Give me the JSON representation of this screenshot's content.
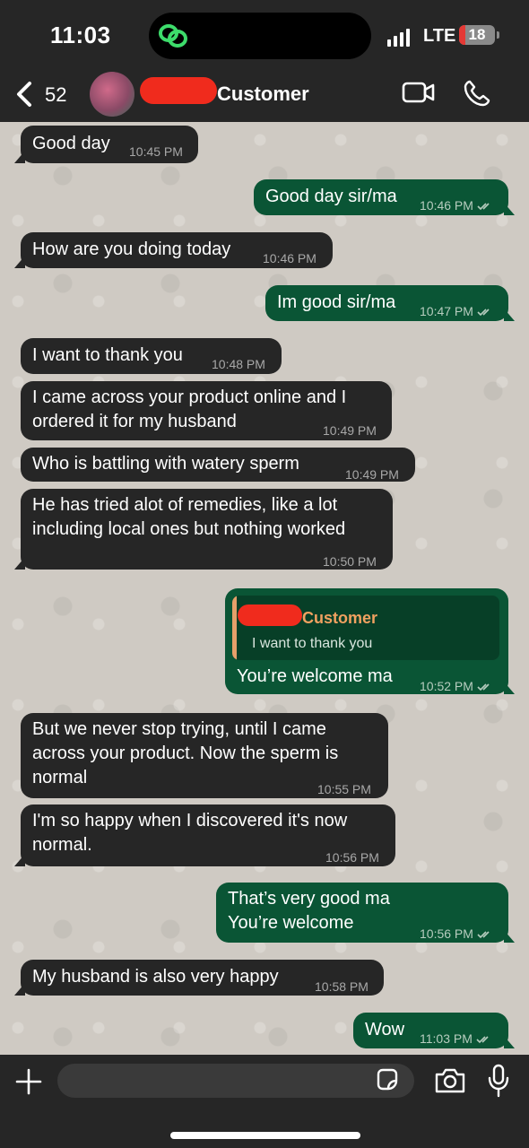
{
  "status_bar": {
    "time": "11:03",
    "network": "LTE",
    "battery_level": "18",
    "battery_fraction": 0.18
  },
  "header": {
    "back_count": "52",
    "contact_name": "Customer",
    "icons": [
      "chevron-left-icon",
      "video-call-icon",
      "phone-icon"
    ]
  },
  "messages": [
    {
      "dir": "in",
      "text": "Good day",
      "time": "10:45 PM"
    },
    {
      "dir": "out",
      "text": "Good day sir/ma",
      "time": "10:46 PM"
    },
    {
      "dir": "in",
      "text": "How are you doing today",
      "time": "10:46 PM"
    },
    {
      "dir": "out",
      "text": "Im good sir/ma",
      "time": "10:47 PM"
    },
    {
      "dir": "in",
      "text": "I want to thank you",
      "time": "10:48 PM"
    },
    {
      "dir": "in",
      "lines": [
        "I came across your product online and I",
        "ordered it for my husband"
      ],
      "time": "10:49 PM"
    },
    {
      "dir": "in",
      "text": "Who is battling with watery sperm",
      "time": "10:49 PM"
    },
    {
      "dir": "in",
      "lines": [
        "He has tried alot of remedies, like a lot",
        "including local ones but nothing worked"
      ],
      "time": "10:50 PM"
    },
    {
      "dir": "out",
      "quote_name": "Customer",
      "quote_text": "I want to thank you",
      "text": "You’re welcome ma",
      "time": "10:52 PM"
    },
    {
      "dir": "in",
      "lines": [
        "But we never stop trying, until I came",
        "across your product. Now the sperm is",
        "normal"
      ],
      "time": "10:55 PM"
    },
    {
      "dir": "in",
      "lines": [
        "I'm so happy when I discovered it's now",
        "normal."
      ],
      "time": "10:56 PM"
    },
    {
      "dir": "out",
      "lines": [
        "That’s very good ma",
        "You’re welcome"
      ],
      "time": "10:56 PM"
    },
    {
      "dir": "in",
      "text": "My husband is also very happy",
      "time": "10:58 PM"
    },
    {
      "dir": "out",
      "text": "Wow",
      "time": "11:03 PM"
    }
  ],
  "input_bar": {
    "placeholder": "",
    "icons": [
      "plus-icon",
      "sticker-icon",
      "camera-icon",
      "microphone-icon"
    ]
  },
  "colors": {
    "incoming_bubble": "#262626",
    "outgoing_bubble": "#0a5535",
    "chat_background": "#cfcac3",
    "quote_accent": "#f0a160"
  }
}
